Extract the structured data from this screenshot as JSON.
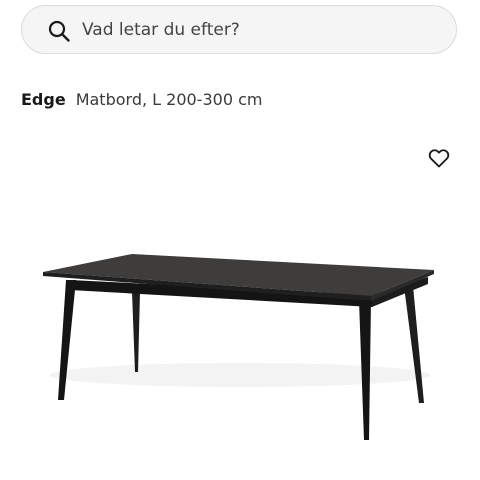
{
  "search": {
    "placeholder": "Vad letar du efter?",
    "value": ""
  },
  "product": {
    "brand": "Edge",
    "description": "Matbord, L 200-300 cm"
  },
  "icons": {
    "search": "search-icon",
    "favorite": "heart-outline-icon"
  },
  "colors": {
    "search_background": "#f5f5f5",
    "search_border": "#dcdcdc",
    "text_primary": "#1a1a1a",
    "table_top": "#3d3b39",
    "table_legs": "#1a1a1a"
  }
}
